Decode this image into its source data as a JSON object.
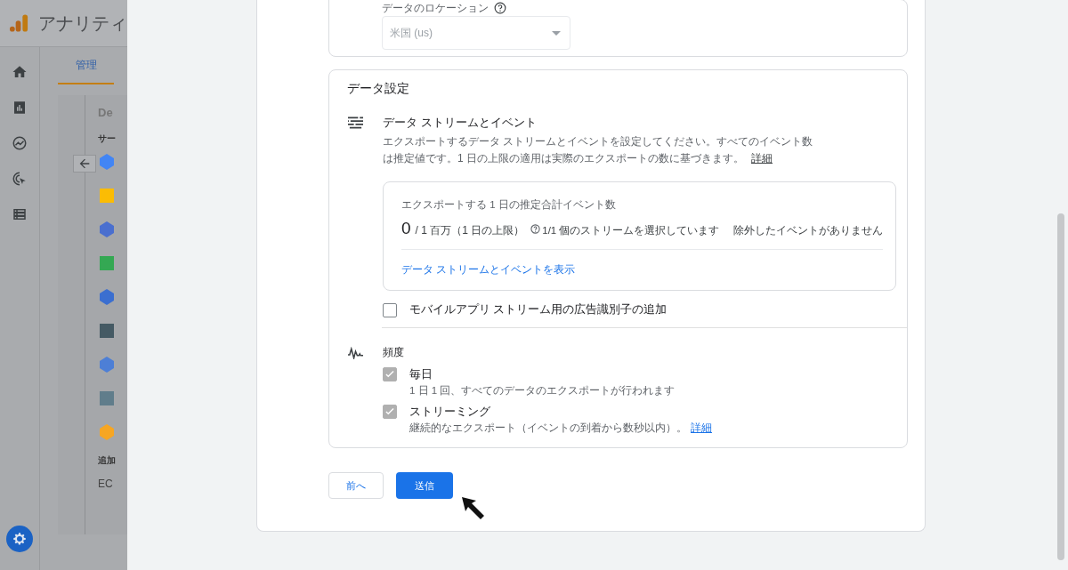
{
  "app": {
    "title": "アナリティ"
  },
  "admin_tab": {
    "label": "管理",
    "selected": true
  },
  "side_list": {
    "header": "De",
    "section": "サー",
    "footer_section": "追加",
    "footer_item": "EC"
  },
  "location": {
    "label": "データのロケーション",
    "value": "米国 (us)",
    "disabled": true
  },
  "data_settings": {
    "title": "データ設定",
    "streams": {
      "title": "データ ストリームとイベント",
      "description": "エクスポートするデータ ストリームとイベントを設定してください。すべてのイベント数は推定値です。1 日の上限の適用は実際のエクスポートの数に基づきます。",
      "link": "詳細",
      "summary": {
        "label": "エクスポートする 1 日の推定合計イベント数",
        "count": "0",
        "limit": "/ 1 百万（1 日の上限）",
        "streams": "1/1 個のストリームを選択しています",
        "excluded": "除外したイベントがありません",
        "link": "データ ストリームとイベントを表示"
      }
    },
    "ad_id": {
      "label": "モバイルアプリ ストリーム用の広告識別子の追加",
      "checked": false
    },
    "frequency": {
      "title": "頻度",
      "options": [
        {
          "label": "毎日",
          "description": "1 日 1 回、すべてのデータのエクスポートが行われます",
          "checked": true,
          "disabled": true
        },
        {
          "label": "ストリーミング",
          "description": "継続的なエクスポート（イベントの到着から数秒以内）。",
          "link": "詳細",
          "checked": true,
          "disabled": true
        }
      ]
    }
  },
  "buttons": [
    {
      "label": "前へ",
      "kind": "secondary"
    },
    {
      "label": "送信",
      "kind": "primary"
    }
  ]
}
